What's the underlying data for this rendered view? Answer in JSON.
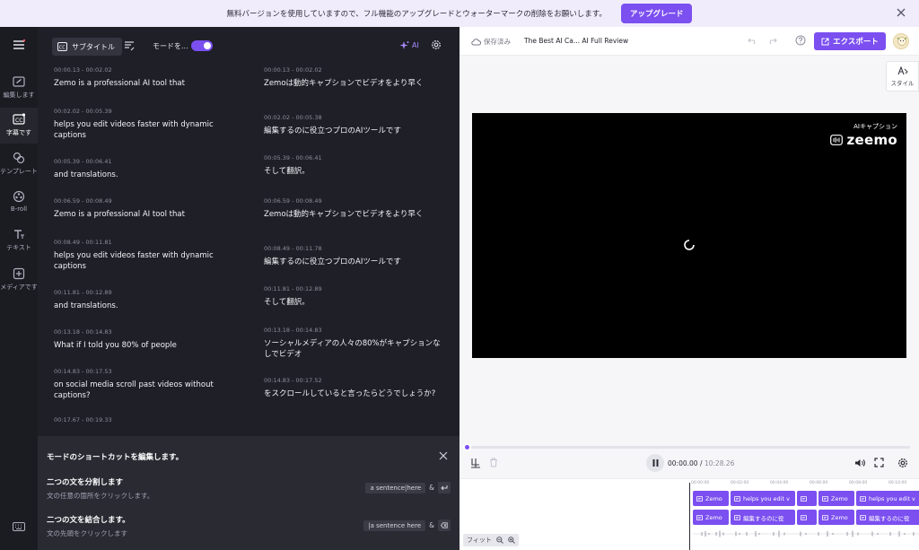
{
  "banner": {
    "message": "無料バージョンを使用していますので、フル機能のアップグレードとウォーターマークの削除をお願いします。",
    "upgrade_label": "アップグレード"
  },
  "rail": {
    "items": [
      {
        "label": "編集します",
        "icon": "edit-icon"
      },
      {
        "label": "字幕です",
        "icon": "subtitle-icon"
      },
      {
        "label": "テンプレート",
        "icon": "template-icon"
      },
      {
        "label": "B-roll",
        "icon": "broll-icon"
      },
      {
        "label": "テキスト",
        "icon": "text-icon"
      },
      {
        "label": "メディアです",
        "icon": "media-icon"
      }
    ]
  },
  "panel": {
    "subtitle_tab": "サブタイトル",
    "mode_label": "モードを...",
    "ai_label": "AI"
  },
  "subtitles": {
    "original": [
      {
        "time": "00:00.13 - 00:02.02",
        "text": "Zemo is a professional AI tool that"
      },
      {
        "time": "00:02.02 - 00:05.39",
        "text": "helps you edit videos faster with dynamic captions"
      },
      {
        "time": "00:05.39 - 00:06.41",
        "text": "and translations."
      },
      {
        "time": "00:06.59 - 00:08.49",
        "text": "Zemo is a professional AI tool that"
      },
      {
        "time": "00:08.49 - 00:11.81",
        "text": "helps you edit videos faster with dynamic captions"
      },
      {
        "time": "00:11.81 - 00:12.89",
        "text": "and translations."
      },
      {
        "time": "00:13.18 - 00:14.83",
        "text": "What if I told you 80% of people"
      },
      {
        "time": "00:14.83 - 00:17.53",
        "text": "on social media scroll past videos without captions?"
      },
      {
        "time": "00:17.67 - 00:19.33",
        "text": ""
      }
    ],
    "translated": [
      {
        "time": "00:00.13 - 00:02.02",
        "text": "Zemoは動的キャプションでビデオをより早く"
      },
      {
        "time": "00:02.02 - 00:05.38",
        "text": "編集するのに役立つプロのAIツールです"
      },
      {
        "time": "00:05.39 - 00:06.41",
        "text": "そして翻訳。"
      },
      {
        "time": "00:06.59 - 00:08.49",
        "text": "Zemoは動的キャプションでビデオをより早く"
      },
      {
        "time": "00:08.49 - 00:11.78",
        "text": "編集するのに役立つプロのAIツールです"
      },
      {
        "time": "00:11.81 - 00:12.89",
        "text": "そして翻訳。"
      },
      {
        "time": "00:13.18 - 00:14.83",
        "text": "ソーシャルメディアの人々の80%がキャプションなしでビデオ"
      },
      {
        "time": "00:14.83 - 00:17.52",
        "text": "をスクロールしていると言ったらどうでしょうか?"
      }
    ]
  },
  "shortcut": {
    "title": "モードのショートカットを編集します。",
    "split": {
      "name": "二つの文を分割します",
      "hint": "文の任意の箇所をクリックします。",
      "key_chip": "a sentence|here",
      "amp": "&"
    },
    "merge": {
      "name": "二つの文を結合します。",
      "hint": "文の先頭をクリックします",
      "key_chip": "|a sentence here",
      "amp": "&"
    }
  },
  "editor": {
    "saved_label": "保存済み",
    "doc_title": "The Best AI Ca... AI Full Review",
    "export_label": "エクスポート",
    "style_label": "スタイル",
    "watermark_caption": "AIキャプション",
    "watermark_brand": "zeemo",
    "time_current": "00:00.00",
    "time_separator": "/",
    "time_total": "10:28.26",
    "progress": 0
  },
  "timeline": {
    "ruler": [
      "00:00:00",
      "00:02:00",
      "00:04:00",
      "00:06:00",
      "00:08:00",
      "00:10:00"
    ],
    "track1": [
      {
        "label": "Zemo",
        "w": 40
      },
      {
        "label": "helps you edit v",
        "w": 72
      },
      {
        "label": "",
        "w": 22
      },
      {
        "label": "Zemo",
        "w": 40
      },
      {
        "label": "helps you edit v",
        "w": 72
      }
    ],
    "track2": [
      {
        "label": "Zemo",
        "w": 40
      },
      {
        "label": "編集するのに役",
        "w": 72
      },
      {
        "label": "",
        "w": 22
      },
      {
        "label": "Zemo",
        "w": 40
      },
      {
        "label": "編集するのに役",
        "w": 72
      }
    ],
    "fit_label": "フィット"
  },
  "colors": {
    "accent": "#7b4ff0",
    "panel_bg": "#1f1f27"
  }
}
